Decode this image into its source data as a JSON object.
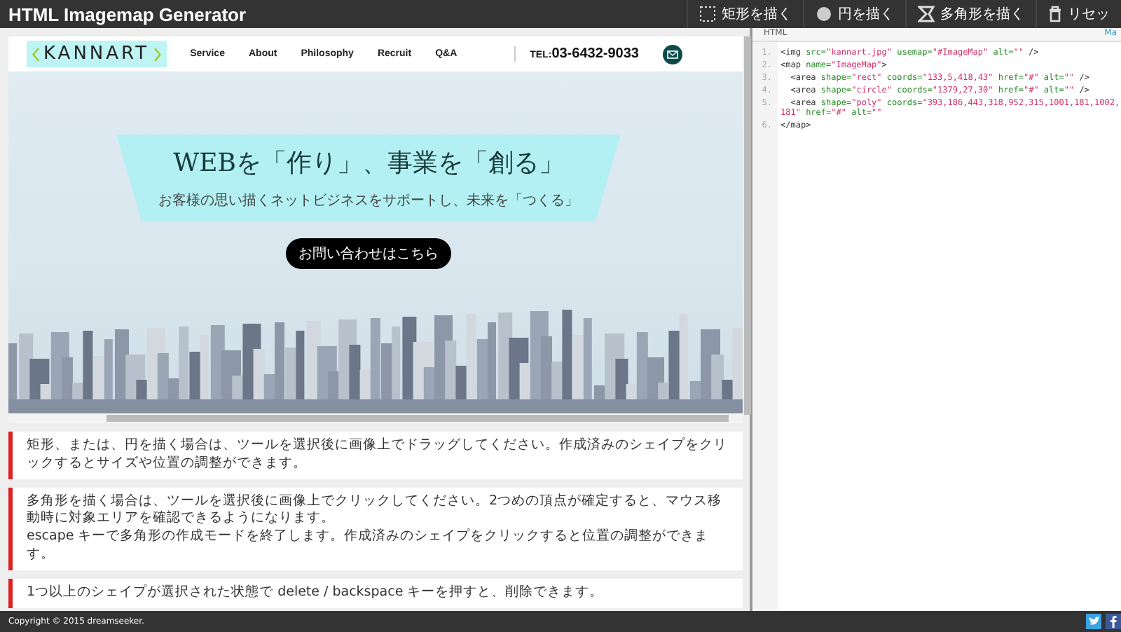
{
  "app_title": "HTML Imagemap Generator",
  "tools": [
    {
      "kind": "rect",
      "label": "矩形を描く"
    },
    {
      "kind": "circle",
      "label": "円を描く"
    },
    {
      "kind": "poly",
      "label": "多角形を描く"
    },
    {
      "kind": "trash",
      "label": "リセッ"
    }
  ],
  "preview": {
    "logo": "KANNART",
    "nav": [
      "Service",
      "About",
      "Philosophy",
      "Recruit",
      "Q&A"
    ],
    "tel_prefix": "TEL:",
    "tel": "03-6432-9033",
    "headline": "WEBを「作り」、事業を「創る」",
    "tagline": "お客様の思い描くネットビジネスをサポートし、未来を「つくる」",
    "cta": "お問い合わせはこちら"
  },
  "notes": [
    [
      "矩形、または、円を描く場合は、ツールを選択後に画像上でドラッグしてください。作成済みのシェイプをクリックするとサイズや位置の調整ができます。"
    ],
    [
      "多角形を描く場合は、ツールを選択後に画像上でクリックしてください。2つめの頂点が確定すると、マウス移動時に対象エリアを確認できるようになります。",
      "escape キーで多角形の作成モードを終了します。作成済みのシェイプをクリックすると位置の調整ができます。"
    ],
    [
      "1つ以上のシェイプが選択された状態で delete / backspace キーを押すと、削除できます。"
    ]
  ],
  "code_panel": {
    "title": "HTML",
    "link": "Ma",
    "lines": [
      {
        "number": "1.",
        "tokens": [
          {
            "kind": "tag",
            "text": "<img "
          },
          {
            "kind": "attr",
            "text": "src="
          },
          {
            "kind": "value",
            "text": "\"kannart.jpg\""
          },
          {
            "kind": "attr",
            "text": " usemap="
          },
          {
            "kind": "value",
            "text": "\"#ImageMap\""
          },
          {
            "kind": "attr",
            "text": " alt="
          },
          {
            "kind": "value",
            "text": "\"\""
          },
          {
            "kind": "tag",
            "text": " />"
          }
        ]
      },
      {
        "number": "2.",
        "tokens": [
          {
            "kind": "tag",
            "text": "<map "
          },
          {
            "kind": "attr",
            "text": "name="
          },
          {
            "kind": "value",
            "text": "\"ImageMap\""
          },
          {
            "kind": "tag",
            "text": ">"
          }
        ]
      },
      {
        "number": "3.",
        "tokens": [
          {
            "kind": "tag",
            "text": "  <area "
          },
          {
            "kind": "attr",
            "text": "shape="
          },
          {
            "kind": "value",
            "text": "\"rect\""
          },
          {
            "kind": "attr",
            "text": " coords="
          },
          {
            "kind": "value",
            "text": "\"133,5,418,43\""
          },
          {
            "kind": "attr",
            "text": " href="
          },
          {
            "kind": "value",
            "text": "\"#\""
          },
          {
            "kind": "attr",
            "text": " alt="
          },
          {
            "kind": "value",
            "text": "\"\""
          },
          {
            "kind": "tag",
            "text": " />"
          }
        ]
      },
      {
        "number": "4.",
        "tokens": [
          {
            "kind": "tag",
            "text": "  <area "
          },
          {
            "kind": "attr",
            "text": "shape="
          },
          {
            "kind": "value",
            "text": "\"circle\""
          },
          {
            "kind": "attr",
            "text": " coords="
          },
          {
            "kind": "value",
            "text": "\"1379,27,30\""
          },
          {
            "kind": "attr",
            "text": " href="
          },
          {
            "kind": "value",
            "text": "\"#\""
          },
          {
            "kind": "attr",
            "text": " alt="
          },
          {
            "kind": "value",
            "text": "\"\""
          },
          {
            "kind": "tag",
            "text": " />"
          }
        ]
      },
      {
        "number": "5.",
        "tokens": [
          {
            "kind": "tag",
            "text": "  <area "
          },
          {
            "kind": "attr",
            "text": "shape="
          },
          {
            "kind": "value",
            "text": "\"poly\""
          },
          {
            "kind": "attr",
            "text": " coords="
          },
          {
            "kind": "value",
            "text": "\"393,186,443,318,952,315,1001,181,1002,181\""
          },
          {
            "kind": "attr",
            "text": " href="
          },
          {
            "kind": "value",
            "text": "\"#\""
          },
          {
            "kind": "attr",
            "text": " alt="
          },
          {
            "kind": "value",
            "text": "\"\""
          }
        ]
      },
      {
        "number": "6.",
        "tokens": [
          {
            "kind": "tag",
            "text": "</map>"
          }
        ]
      }
    ]
  },
  "footer": {
    "copyright": "Copyright © 2015 dreamseeker."
  }
}
